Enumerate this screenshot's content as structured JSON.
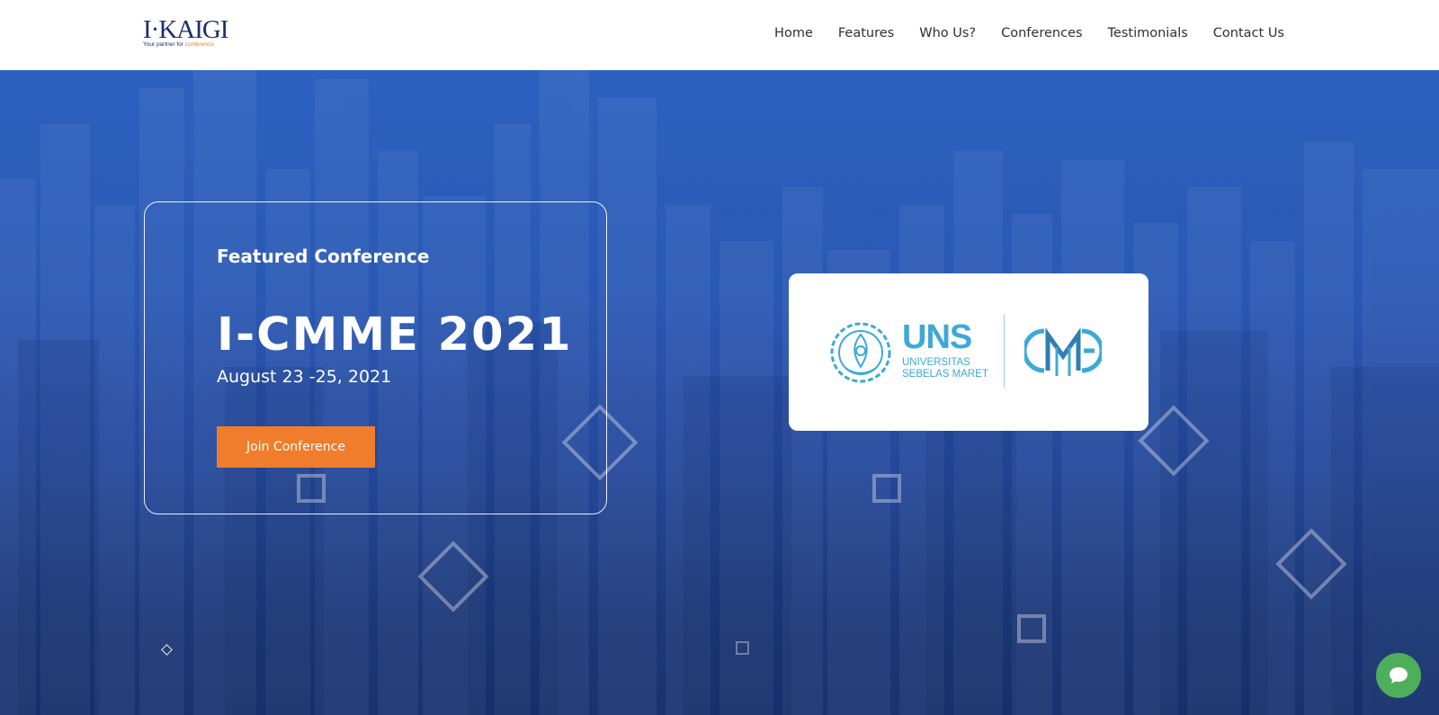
{
  "header": {
    "logo_text": "I·KAIGI",
    "logo_tagline_prefix": "Your partner for",
    "logo_tagline_accent": "conference",
    "nav": [
      {
        "label": "Home"
      },
      {
        "label": "Features"
      },
      {
        "label": "Who Us?"
      },
      {
        "label": "Conferences"
      },
      {
        "label": "Testimonials"
      },
      {
        "label": "Contact Us"
      }
    ]
  },
  "hero": {
    "featured_label": "Featured Conference",
    "conference_title": "I-CMME 2021",
    "conference_date": "August 23 -25, 2021",
    "join_button": "Join Conference",
    "partner_logo": {
      "university_short": "UNS",
      "university_line1": "UNIVERSITAS",
      "university_line2": "SEBELAS MARET",
      "mark_text": "CMME"
    }
  },
  "chat": {
    "icon": "chat-bubble-icon"
  },
  "colors": {
    "brand_navy": "#1c2f6b",
    "accent_orange": "#ef7d2b",
    "hero_blue": "#2d61c0",
    "hero_dark": "#1a3370",
    "uns_blue": "#3ea8d8",
    "chat_green": "#4fae5c"
  }
}
